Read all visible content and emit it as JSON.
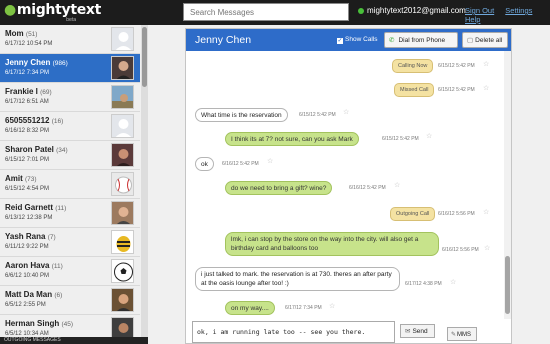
{
  "app": {
    "logo_text": "mightytext",
    "beta_label": "beta",
    "search_placeholder": "Search Messages",
    "account_email": "mightytext2012@gmail.com",
    "links": [
      "Sign Out",
      "Settings",
      "Help"
    ]
  },
  "contacts": [
    {
      "name": "Mom",
      "count": "(51)",
      "date": "6/17/12 10:54 PM"
    },
    {
      "name": "Jenny Chen",
      "count": "(986)",
      "date": "6/17/12 7:34 PM"
    },
    {
      "name": "Frankie I",
      "count": "(69)",
      "date": "6/17/12 6:51 AM"
    },
    {
      "name": "6505551212",
      "count": "(16)",
      "date": "6/16/12 8:32 PM"
    },
    {
      "name": "Sharon Patel",
      "count": "(34)",
      "date": "6/15/12 7:01 PM"
    },
    {
      "name": "Amit",
      "count": "(73)",
      "date": "6/15/12 4:54 PM"
    },
    {
      "name": "Reid Garnett",
      "count": "(11)",
      "date": "6/13/12 12:38 PM"
    },
    {
      "name": "Yash Rana",
      "count": "(7)",
      "date": "6/11/12 9:22 PM"
    },
    {
      "name": "Aaron Hava",
      "count": "(11)",
      "date": "6/6/12 10:40 PM"
    },
    {
      "name": "Matt Da Man",
      "count": "(6)",
      "date": "6/5/12 2:55 PM"
    },
    {
      "name": "Herman Singh",
      "count": "(45)",
      "date": "6/5/12 10:34 AM"
    }
  ],
  "outgoing_header": "OUTGOING MESSAGES",
  "conversation": {
    "title": "Jenny Chen",
    "show_calls_label": "Show Calls",
    "dial_label": "Dial from Phone",
    "delete_label": "Delete all",
    "messages": [
      {
        "kind": "call",
        "text": "Calling Now",
        "time": "6/15/12 5:42 PM"
      },
      {
        "kind": "call",
        "text": "Missed Call",
        "time": "6/15/12 5:42 PM"
      },
      {
        "kind": "in",
        "text": "What time is the reservation",
        "time": "6/15/12 5:42 PM"
      },
      {
        "kind": "out",
        "text": "I think its at 7? not sure, can you ask Mark",
        "time": "6/15/12 5:42 PM"
      },
      {
        "kind": "in",
        "text": "ok",
        "time": "6/16/12 5:42 PM"
      },
      {
        "kind": "out",
        "text": "do we need to bring a gift? wine?",
        "time": "6/16/12 5:42 PM"
      },
      {
        "kind": "call",
        "text": "Outgoing Call",
        "time": "6/16/12 5:56 PM"
      },
      {
        "kind": "out",
        "text": "lmk, i can stop by the store on the way into the city. will also get a birthday card and balloons too",
        "time": "6/16/12 5:56 PM"
      },
      {
        "kind": "in",
        "text": "i just talked to mark. the reservation is at 730. theres an after party at the oasis lounge after too! :)",
        "time": "6/17/12 4:38 PM"
      },
      {
        "kind": "out",
        "text": "on my way....",
        "time": "6/17/12 7:34 PM"
      }
    ],
    "compose_value": "ok, i am running late too -- see you there.",
    "send_label": "Send",
    "mms_label": "MMS"
  }
}
